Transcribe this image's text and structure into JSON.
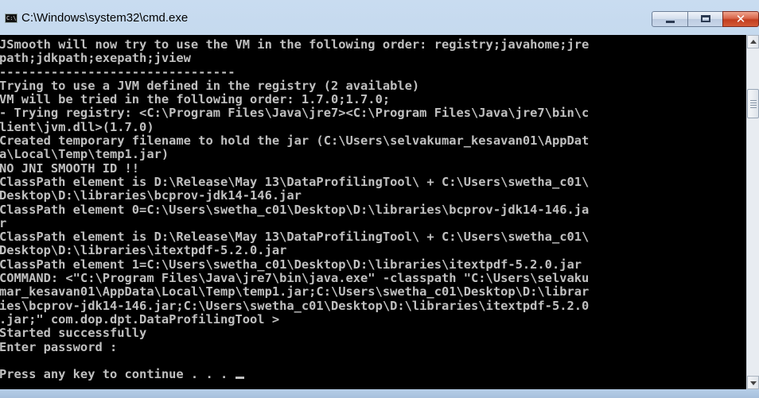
{
  "window": {
    "title": "C:\\Windows\\system32\\cmd.exe",
    "icon": "cmd-icon",
    "icon_text": "C:\\"
  },
  "controls": {
    "minimize_icon": "minimize-icon",
    "maximize_icon": "maximize-icon",
    "close_icon": "close-icon",
    "close_glyph": "✕"
  },
  "console": {
    "text": "JSmooth will now try to use the VM in the following order: registry;javahome;jre\npath;jdkpath;exepath;jview\n--------------------------------\nTrying to use a JVM defined in the registry (2 available)\nVM will be tried in the following order: 1.7.0;1.7.0;\n- Trying registry: <C:\\Program Files\\Java\\jre7><C:\\Program Files\\Java\\jre7\\bin\\c\nlient\\jvm.dll>(1.7.0)\nCreated temporary filename to hold the jar (C:\\Users\\selvakumar_kesavan01\\AppDat\na\\Local\\Temp\\temp1.jar)\nNO JNI SMOOTH ID !!\nClassPath element is D:\\Release\\May 13\\DataProfilingTool\\ + C:\\Users\\swetha_c01\\\nDesktop\\D:\\libraries\\bcprov-jdk14-146.jar\nClassPath element 0=C:\\Users\\swetha_c01\\Desktop\\D:\\libraries\\bcprov-jdk14-146.ja\nr\nClassPath element is D:\\Release\\May 13\\DataProfilingTool\\ + C:\\Users\\swetha_c01\\\nDesktop\\D:\\libraries\\itextpdf-5.2.0.jar\nClassPath element 1=C:\\Users\\swetha_c01\\Desktop\\D:\\libraries\\itextpdf-5.2.0.jar\nCOMMAND: <\"C:\\Program Files\\Java\\jre7\\bin\\java.exe\" -classpath \"C:\\Users\\selvaku\nmar_kesavan01\\AppData\\Local\\Temp\\temp1.jar;C:\\Users\\swetha_c01\\Desktop\\D:\\librar\nies\\bcprov-jdk14-146.jar;C:\\Users\\swetha_c01\\Desktop\\D:\\libraries\\itextpdf-5.2.0\n.jar;\" com.dop.dpt.DataProfilingTool >\nStarted successfully\nEnter password :\n\nPress any key to continue . . . ",
    "text_color": "#c0c0c0",
    "background": "#000000"
  },
  "scrollbar": {
    "up_icon": "scroll-up-arrow-icon",
    "down_icon": "scroll-down-arrow-icon",
    "position_fraction": 0.0
  }
}
